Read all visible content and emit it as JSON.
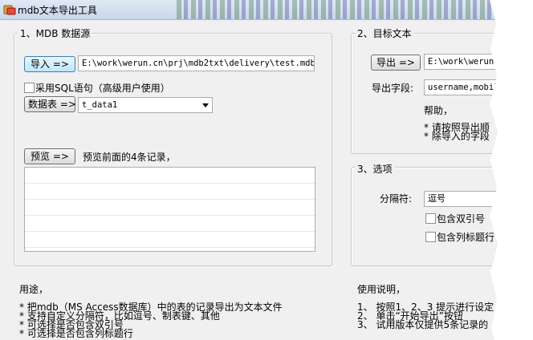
{
  "window": {
    "title": "mdb文本导出工具"
  },
  "section1": {
    "title": "1、MDB 数据源",
    "import_button": "导入 =>",
    "mdb_path": "E:\\work\\werun.cn\\prj\\mdb2txt\\delivery\\test.mdb",
    "use_sql_label": "采用SQL语句（高级用户使用）",
    "table_button": "数据表 =>",
    "table_selected": "t_data1",
    "preview_button": "预览 =>",
    "preview_hint": "预览前面的4条记录，"
  },
  "section2": {
    "title": "2、目标文本",
    "export_button": "导出 =>",
    "export_path": "E:\\work\\werun",
    "fields_label": "导出字段:",
    "fields_value": "username,mobil",
    "help_label": "帮助，",
    "help_items": [
      "* 请按照导出顺",
      "* 除导入的字段"
    ]
  },
  "section3": {
    "title": "3、选项",
    "separator_label": "分隔符:",
    "separator_value": "逗号",
    "include_quotes_label": "包含双引号",
    "include_header_label": "包含列标题行"
  },
  "usage_left": {
    "title": "用途，",
    "items": [
      "* 把mdb（MS Access数据库）中的表的记录导出为文本文件",
      "* 支持自定义分隔符，比如逗号、制表键、其他",
      "* 可选择是否包含双引号",
      "* 可选择是否包含列标题行"
    ]
  },
  "usage_right": {
    "title": "使用说明，",
    "items": [
      "1、  按照1、2、3 提示进行设定",
      "2、  单击“开始导出”按钮",
      "3、  试用版本仅提供5条记录的"
    ]
  },
  "colors": {
    "accent": "#3c7fb1",
    "panel_bg": "#f0f0f0"
  },
  "icons": {
    "app": "app-icon",
    "dropdown": "chevron-down-icon"
  }
}
